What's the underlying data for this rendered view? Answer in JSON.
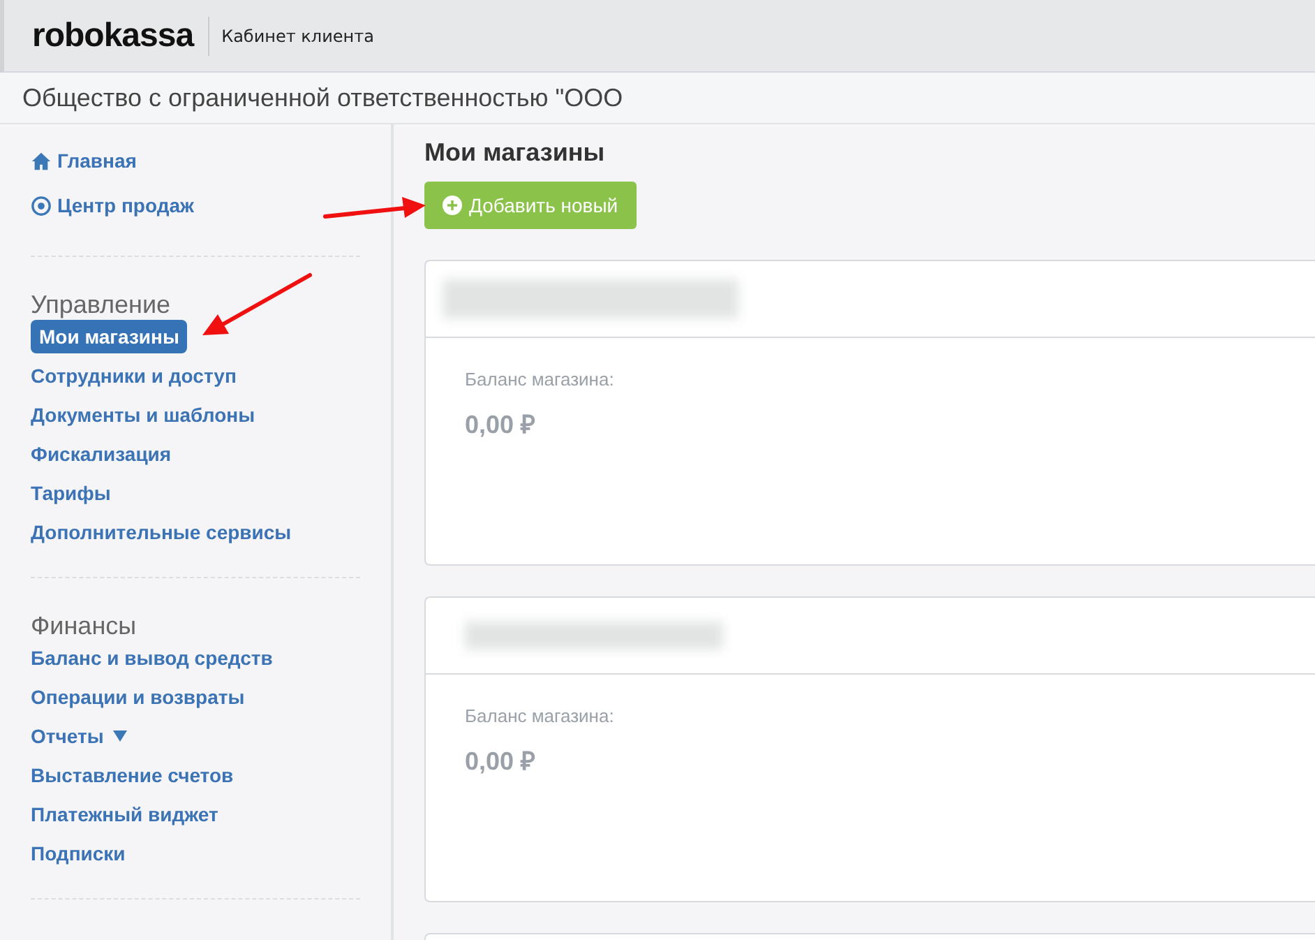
{
  "header": {
    "logo": "robokassa",
    "title": "Кабинет клиента"
  },
  "company": {
    "name": "Общество с ограниченной ответственностью \"ООО"
  },
  "sidebar": {
    "groups": [
      {
        "items": [
          {
            "label": "Главная",
            "kind": "home",
            "selected": false
          },
          {
            "label": "Центр продаж",
            "kind": "target",
            "selected": false
          }
        ]
      },
      {
        "title": "Управление",
        "items": [
          {
            "label": "Мои магазины",
            "kind": "link",
            "selected": true
          },
          {
            "label": "Сотрудники и доступ",
            "kind": "link",
            "selected": false
          },
          {
            "label": "Документы и шаблоны",
            "kind": "link",
            "selected": false
          },
          {
            "label": "Фискализация",
            "kind": "link",
            "selected": false
          },
          {
            "label": "Тарифы",
            "kind": "link",
            "selected": false
          },
          {
            "label": "Дополнительные сервисы",
            "kind": "link",
            "selected": false
          }
        ]
      },
      {
        "title": "Финансы",
        "items": [
          {
            "label": "Баланс и вывод средств",
            "kind": "link",
            "selected": false
          },
          {
            "label": "Операции и возвраты",
            "kind": "link",
            "selected": false
          },
          {
            "label": "Отчеты",
            "kind": "dropdown",
            "selected": false
          },
          {
            "label": "Выставление счетов",
            "kind": "link",
            "selected": false
          },
          {
            "label": "Платежный виджет",
            "kind": "link",
            "selected": false
          },
          {
            "label": "Подписки",
            "kind": "link",
            "selected": false
          }
        ]
      }
    ]
  },
  "main": {
    "title": "Мои магазины",
    "add_button": "Добавить новый",
    "stores": [
      {
        "balance_label": "Баланс магазина:",
        "balance": "0,00 ₽"
      },
      {
        "balance_label": "Баланс магазина:",
        "balance": "0,00 ₽"
      }
    ]
  }
}
